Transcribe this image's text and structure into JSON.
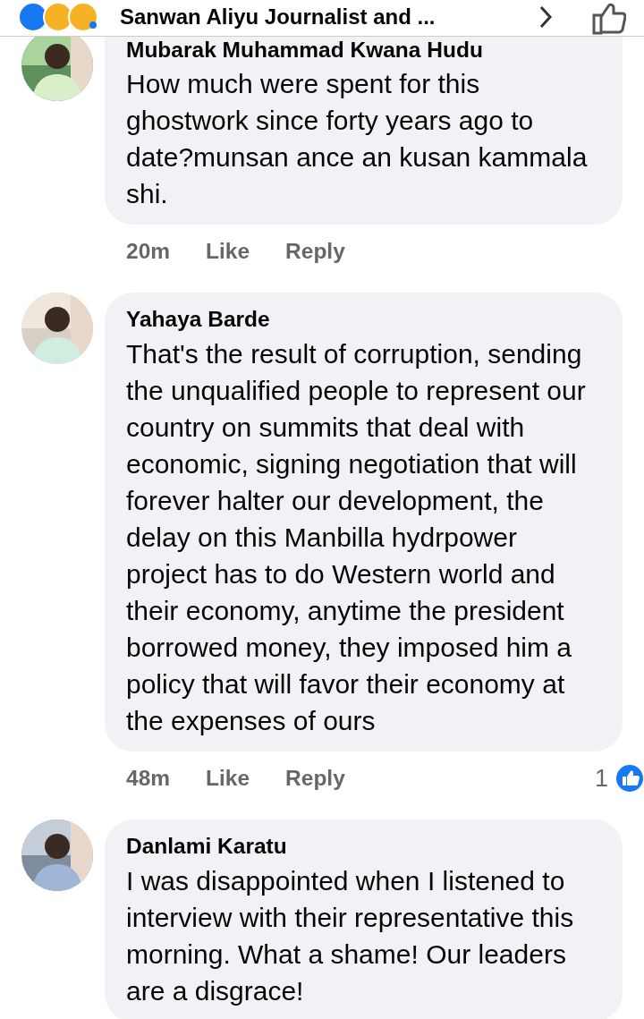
{
  "header": {
    "title": "Sanwan Aliyu Journalist and ..."
  },
  "comments": [
    {
      "author": "Mubarak Muhammad Kwana Hudu",
      "text": "How much were spent for this ghostwork since forty years ago to date?munsan ance an kusan kammala shi.",
      "time": "20m",
      "like": "Like",
      "reply": "Reply"
    },
    {
      "author": "Yahaya Barde",
      "text": "That's the result of corruption, sending the unqualified people to represent our country on summits that deal with economic, signing negotiation that will forever halter our development, the delay on this Manbilla hydrpower project has to do Western world and their economy, anytime the president borrowed money, they imposed him a policy that will favor their economy at the expenses of ours",
      "time": "48m",
      "like": "Like",
      "reply": "Reply",
      "reactions": "1"
    },
    {
      "author": "Danlami Karatu",
      "text": "I was disappointed when I listened to interview with their representative this morning. What a shame! Our leaders are a disgrace!"
    }
  ]
}
